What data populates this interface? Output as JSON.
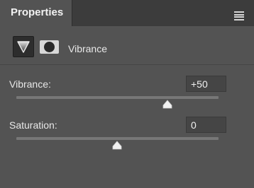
{
  "panel": {
    "tab_title": "Properties",
    "menu_icon": "hamburger-menu-icon",
    "adjustment_icon": "adjustment-triangle-icon",
    "mask_icon": "layer-mask-icon",
    "adjustment_name": "Vibrance"
  },
  "sliders": [
    {
      "label": "Vibrance:",
      "value": "+50",
      "numeric_value": 50,
      "min": -100,
      "max": 100
    },
    {
      "label": "Saturation:",
      "value": "0",
      "numeric_value": 0,
      "min": -100,
      "max": 100
    }
  ],
  "colors": {
    "panel_bg": "#535353",
    "header_bg": "#3c3c3c",
    "track": "#777777",
    "thumb": "#f2f2f2",
    "text": "#e8e8e8"
  }
}
